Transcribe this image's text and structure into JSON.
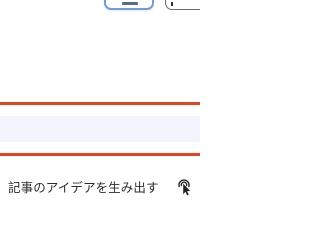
{
  "footer": {
    "label": "記事のアイデアを生み出す",
    "icon": "click-cursor-icon"
  },
  "colors": {
    "accent_border": "#e8431f",
    "input_fill": "#f2f5fd",
    "primary_button_border": "#6f9be3"
  }
}
